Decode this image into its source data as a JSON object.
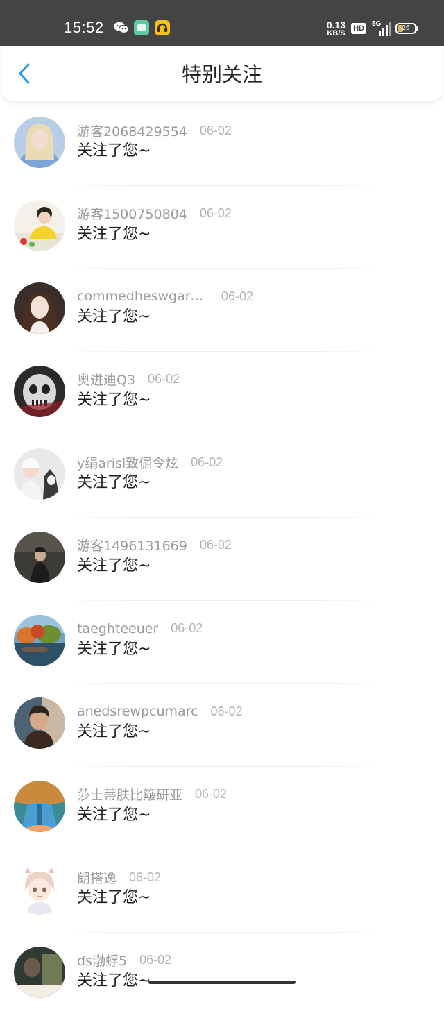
{
  "status_bar": {
    "time": "15:52",
    "net_speed_value": "0.13",
    "net_speed_unit": "KB/S",
    "hd_label": "HD",
    "network_label": "5G",
    "battery_level": "26",
    "icons": [
      "wechat-icon",
      "green-app-icon",
      "yellow-app-icon"
    ]
  },
  "header": {
    "title": "特别关注",
    "back_icon": "chevron-left-icon",
    "accent_color": "#2196f3"
  },
  "notifications": [
    {
      "user": "游客2068429554",
      "date": "06-02",
      "message": "关注了您~"
    },
    {
      "user": "游客1500750804",
      "date": "06-02",
      "message": "关注了您~"
    },
    {
      "user": "commedheswgarc...",
      "date": "06-02",
      "message": "关注了您~"
    },
    {
      "user": "奥进迪Q3",
      "date": "06-02",
      "message": "关注了您~"
    },
    {
      "user": "y绢arisl致倔令炫",
      "date": "06-02",
      "message": "关注了您~"
    },
    {
      "user": "游客1496131669",
      "date": "06-02",
      "message": "关注了您~"
    },
    {
      "user": "taeghteeuer",
      "date": "06-02",
      "message": "关注了您~"
    },
    {
      "user": "anedsrewpcumarc",
      "date": "06-02",
      "message": "关注了您~"
    },
    {
      "user": "莎士蒂肤比簸研亚",
      "date": "06-02",
      "message": "关注了您~"
    },
    {
      "user": "朗搭逸",
      "date": "06-02",
      "message": "关注了您~"
    },
    {
      "user": "ds渤蜉5",
      "date": "06-02",
      "message": "关注了您~"
    }
  ]
}
